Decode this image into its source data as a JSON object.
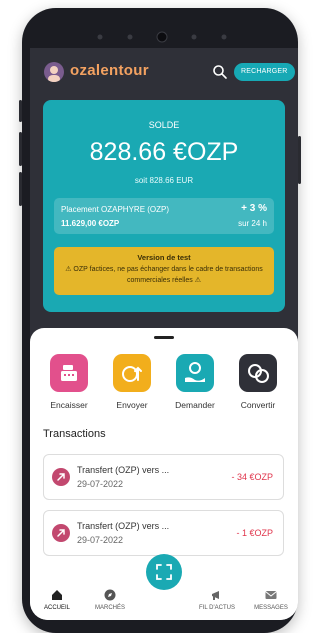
{
  "header": {
    "logo_text": "ozalentour",
    "recharge_label": "RECHARGER"
  },
  "balance": {
    "label": "SOLDE",
    "value": "828.66 €OZP",
    "eur_equivalent": "soit 828.66 EUR"
  },
  "placement": {
    "name": "Placement OZAPHYRE (OZP)",
    "amount": "11.629,00 €OZP",
    "rate": "+ 3 %",
    "period": "sur 24 h"
  },
  "warning": {
    "title": "Version de test",
    "text": "⚠ OZP factices, ne pas échanger dans le cadre de transactions commerciales réelles ⚠"
  },
  "actions": [
    {
      "label": "Encaisser",
      "color": "#e2508c"
    },
    {
      "label": "Envoyer",
      "color": "#f2ae1c"
    },
    {
      "label": "Demander",
      "color": "#1aa9b3"
    },
    {
      "label": "Convertir",
      "color": "#2f3038"
    }
  ],
  "transactions": {
    "title": "Transactions",
    "items": [
      {
        "name": "Transfert (OZP) vers ...",
        "date": "29-07-2022",
        "amount": "- 34 €OZP"
      },
      {
        "name": "Transfert (OZP) vers ...",
        "date": "29-07-2022",
        "amount": "- 1 €OZP"
      }
    ]
  },
  "nav": [
    {
      "label": "ACCUEIL",
      "icon": "home-icon"
    },
    {
      "label": "MARCHÉS",
      "icon": "compass-icon"
    },
    {
      "label": "FIL D'ACTUS",
      "icon": "megaphone-icon"
    },
    {
      "label": "MESSAGES",
      "icon": "mail-icon"
    }
  ],
  "colors": {
    "accent": "#1aa9b3",
    "warning": "#e4b62a",
    "negative": "#e0344b",
    "screen_bg": "#2f3038"
  }
}
